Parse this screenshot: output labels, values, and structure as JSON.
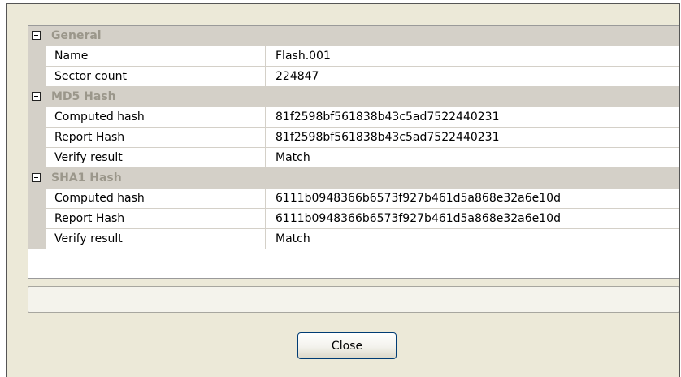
{
  "grid": {
    "categories": [
      {
        "label": "General",
        "rows": [
          {
            "name": "Name",
            "value": "Flash.001"
          },
          {
            "name": "Sector count",
            "value": "224847"
          }
        ]
      },
      {
        "label": "MD5 Hash",
        "rows": [
          {
            "name": "Computed hash",
            "value": "81f2598bf561838b43c5ad7522440231"
          },
          {
            "name": "Report Hash",
            "value": "81f2598bf561838b43c5ad7522440231"
          },
          {
            "name": "Verify result",
            "value": "Match"
          }
        ]
      },
      {
        "label": "SHA1 Hash",
        "rows": [
          {
            "name": "Computed hash",
            "value": "6111b0948366b6573f927b461d5a868e32a6e10d"
          },
          {
            "name": "Report Hash",
            "value": "6111b0948366b6573f927b461d5a868e32a6e10d"
          },
          {
            "name": "Verify result",
            "value": "Match"
          }
        ]
      }
    ]
  },
  "status_text": "",
  "buttons": {
    "close_label": "Close"
  },
  "icons": {
    "expander": "collapse-minus-icon"
  },
  "colors": {
    "category_bg": "#d4d0c8",
    "category_text": "#9b978b",
    "dialog_bg": "#ece9d8"
  }
}
